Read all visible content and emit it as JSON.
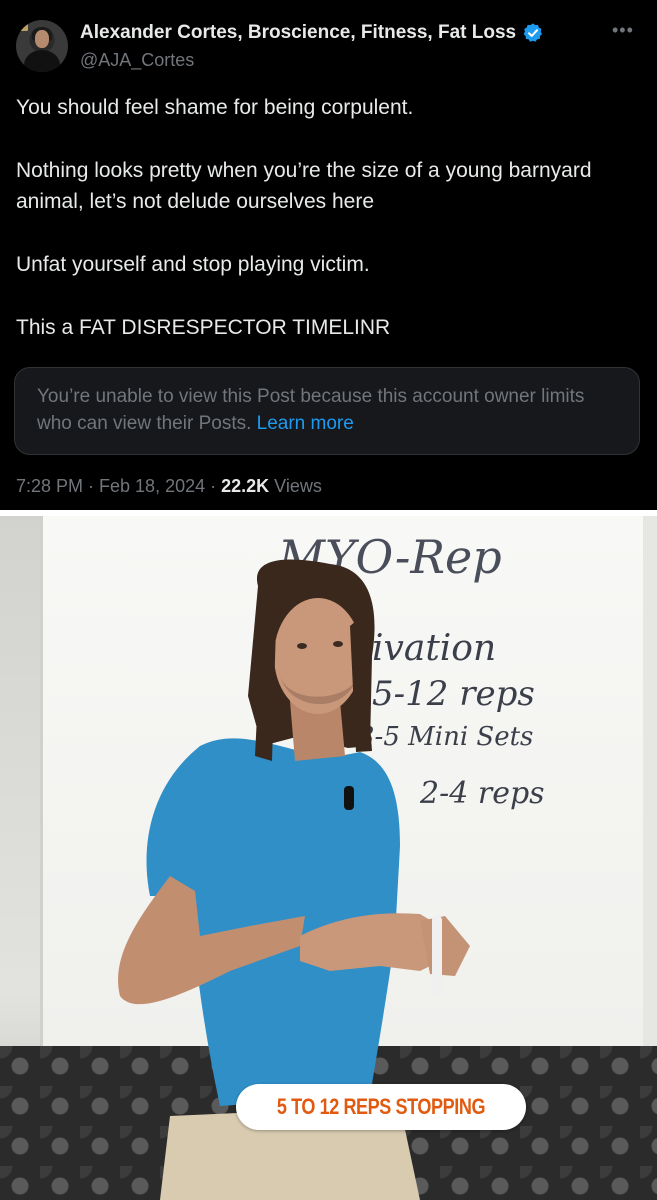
{
  "tweet": {
    "display_name": "Alexander Cortes, Broscience, Fitness, Fat Loss",
    "handle": "@AJA_Cortes",
    "more_icon": "more-horizontal-icon",
    "paragraphs": [
      "You should feel shame for being corpulent.",
      "Nothing looks pretty when you’re the size of a young barnyard animal, let’s not delude ourselves here",
      "Unfat yourself and stop playing victim.",
      "This a FAT DISRESPECTOR TIMELINR"
    ],
    "quoted_notice": {
      "text": "You’re unable to view this Post because this account owner limits who can view their Posts.",
      "link": "Learn more"
    },
    "timestamp": "7:28 PM · Feb 18, 2024 · ",
    "views_count": "22.2K",
    "views_label": " Views"
  },
  "video": {
    "board_lines": [
      "MYO-Rep",
      "ivation",
      "5-12 reps",
      "3-5 Mini Sets",
      "2-4 reps"
    ],
    "caption": "5 TO 12 REPS STOPPING"
  },
  "colors": {
    "background": "#000000",
    "text_primary": "#e7e9ea",
    "text_secondary": "#71767b",
    "link": "#1d9bf0",
    "verified": "#1d9bf0",
    "caption_text": "#e25a10"
  }
}
